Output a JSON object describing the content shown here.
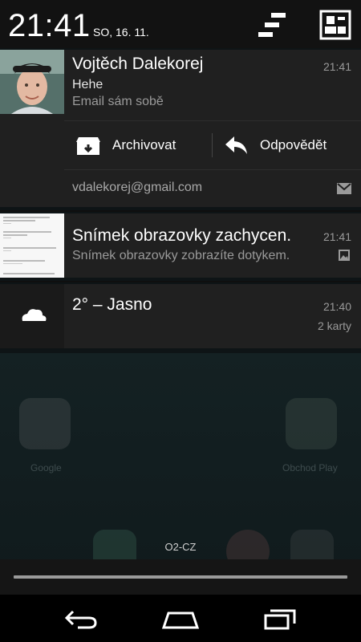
{
  "status_bar": {
    "time": "21:41",
    "date": "SO, 16. 11.",
    "icons": [
      "quick-settings-icon",
      "user-settings-icon"
    ]
  },
  "notifications": [
    {
      "title": "Vojtěch Dalekorej",
      "subject": "Hehe",
      "text": "Email sám sobě",
      "time": "21:41",
      "actions": [
        {
          "label": "Archivovat",
          "icon": "archive-icon"
        },
        {
          "label": "Odpovědět",
          "icon": "reply-icon"
        }
      ],
      "account": "vdalekorej@gmail.com",
      "app_icon": "gmail-icon"
    },
    {
      "title": "Snímek obrazovky zachycen.",
      "text": "Snímek obrazovky zobrazíte dotykem.",
      "time": "21:41",
      "app_icon": "image-icon"
    },
    {
      "title": "2° – Jasno",
      "time": "21:40",
      "info": "2 karty",
      "icon": "cloud-icon"
    }
  ],
  "home_screen": {
    "labels": [
      "Google",
      "Obchod Play"
    ]
  },
  "carrier": "O2-CZ",
  "nav_bar": [
    "back-icon",
    "home-icon",
    "recents-icon"
  ]
}
